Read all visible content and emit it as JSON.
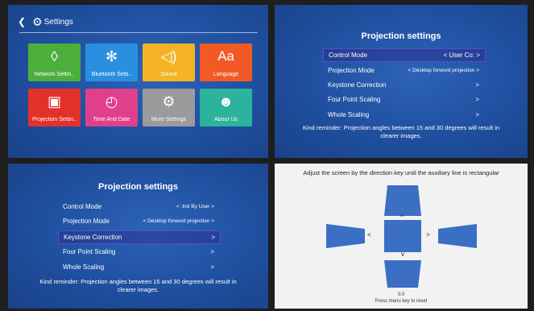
{
  "settings_panel": {
    "back_icon": "back-chevron-icon",
    "title": "Settings",
    "tiles": [
      {
        "label": "Network Settin..",
        "icon": "◐",
        "color": "#4caf3c"
      },
      {
        "label": "Bluetooth Setti..",
        "icon": "✱",
        "color": "#2b8fe0"
      },
      {
        "label": "Sound",
        "icon": "◁)",
        "color": "#f3b325"
      },
      {
        "label": "Language",
        "icon": "Aa",
        "color": "#f15a24"
      },
      {
        "label": "Projection Settin..",
        "icon": "▣",
        "color": "#e4302b"
      },
      {
        "label": "Time And Date",
        "icon": "◴",
        "color": "#e0408b"
      },
      {
        "label": "More Settings",
        "icon": "⚙",
        "color": "#9b9b9b"
      },
      {
        "label": "About Us",
        "icon": "☺",
        "color": "#2bb39b"
      }
    ]
  },
  "projection_a": {
    "title": "Projection settings",
    "rows": [
      {
        "label": "Control Mode",
        "value": "<  User    Co: >"
      },
      {
        "label": "Projection Mode",
        "value": "<  Desktop forword projection  >"
      },
      {
        "label": "Keystone Correction",
        "value": ">"
      },
      {
        "label": "Four Point Scaling",
        "value": ">"
      },
      {
        "label": "Whole Scaling",
        "value": ">"
      }
    ],
    "reminder": "Kind reminder: Projection angles between 15 and 30 degrees will result in clearer images."
  },
  "projection_b": {
    "title": "Projection settings",
    "rows": [
      {
        "label": "Control Mode",
        "value": "<   :trol By User  >"
      },
      {
        "label": "Projection Mode",
        "value": "<  Desktop forword projection  >"
      },
      {
        "label": "Keystone Correction",
        "value": ">"
      },
      {
        "label": "Four Point Scaling",
        "value": ">"
      },
      {
        "label": "Whole Scaling",
        "value": ">"
      }
    ],
    "reminder": "Kind reminder: Projection angles between 15 and 30 degrees will result in clearer images."
  },
  "keystone": {
    "instruction": "Adjust the screen by the direction key until the auxiliary line is rectangular",
    "up": "^",
    "down": "v",
    "left": "<",
    "right": ">",
    "value": "0.0",
    "reset_hint": "Press menu key to reset",
    "accent": "#3a6fc4"
  }
}
